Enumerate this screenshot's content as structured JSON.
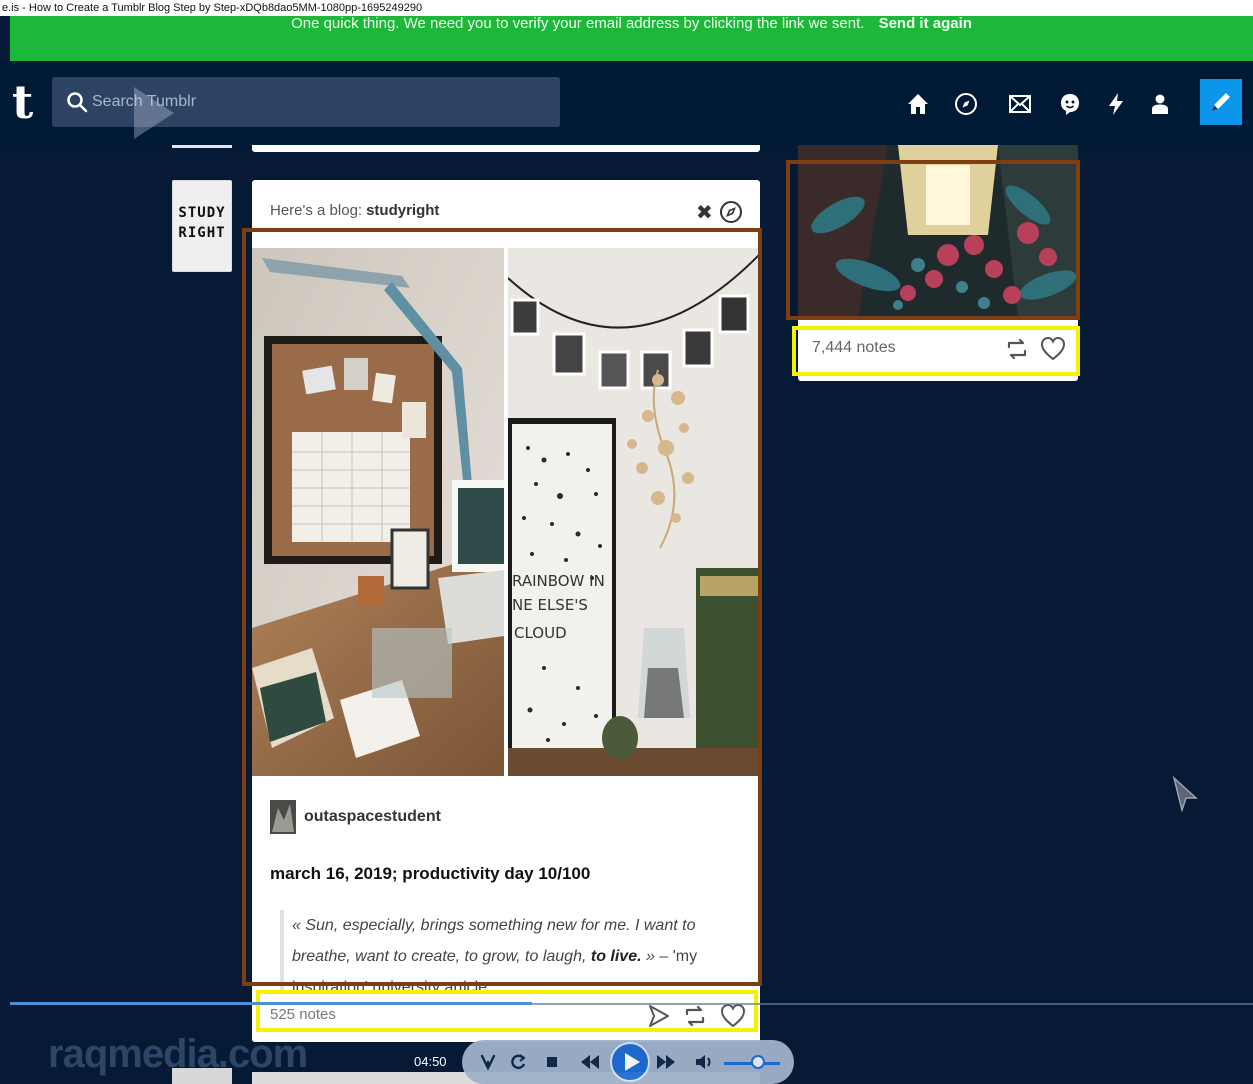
{
  "window_title": "e.is - How to Create a Tumblr Blog Step by Step-xDQb8dao5MM-1080pp-1695249290",
  "banner": {
    "message": "One quick thing.  We need you to verify your email address by clicking the link we sent.",
    "link": "Send it again"
  },
  "topbar": {
    "logo": "t",
    "search_placeholder": "Search Tumblr",
    "nav_icons": [
      "home-icon",
      "explore-icon",
      "inbox-icon",
      "messaging-icon",
      "activity-icon",
      "account-icon"
    ],
    "compose_icon": "pencil-icon"
  },
  "suggested_post": {
    "header_prefix": "Here's a blog:",
    "blog_name": "studyright",
    "avatar_text_line1": "STUDY",
    "avatar_text_line2": "RIGHT",
    "photo_right_caption": [
      "RAINBOW IN",
      "NE ELSE'S",
      "CLOUD"
    ],
    "author": "outaspacestudent",
    "title": "march 16, 2019;  productivity day 10/100",
    "quote_start": "« Sun, especially, brings something new for me. I want to breathe, want to create, to grow, to laugh, ",
    "quote_bold": "to live.",
    "quote_end": " » – ",
    "quote_source": "'my inspiration' university article",
    "notes": "525 notes"
  },
  "art_post": {
    "notes": "7,444 notes"
  },
  "video_player": {
    "watermark": "raqmedia.com",
    "time": "04:50",
    "progress_fraction": 0.42,
    "volume_fraction": 0.6
  },
  "colors": {
    "dashboard_bg": "#061a36",
    "banner_green": "#1db83a",
    "compose_blue": "#0b96ec",
    "annotation_brown": "#7d3e12",
    "annotation_yellow": "#f5f100"
  }
}
